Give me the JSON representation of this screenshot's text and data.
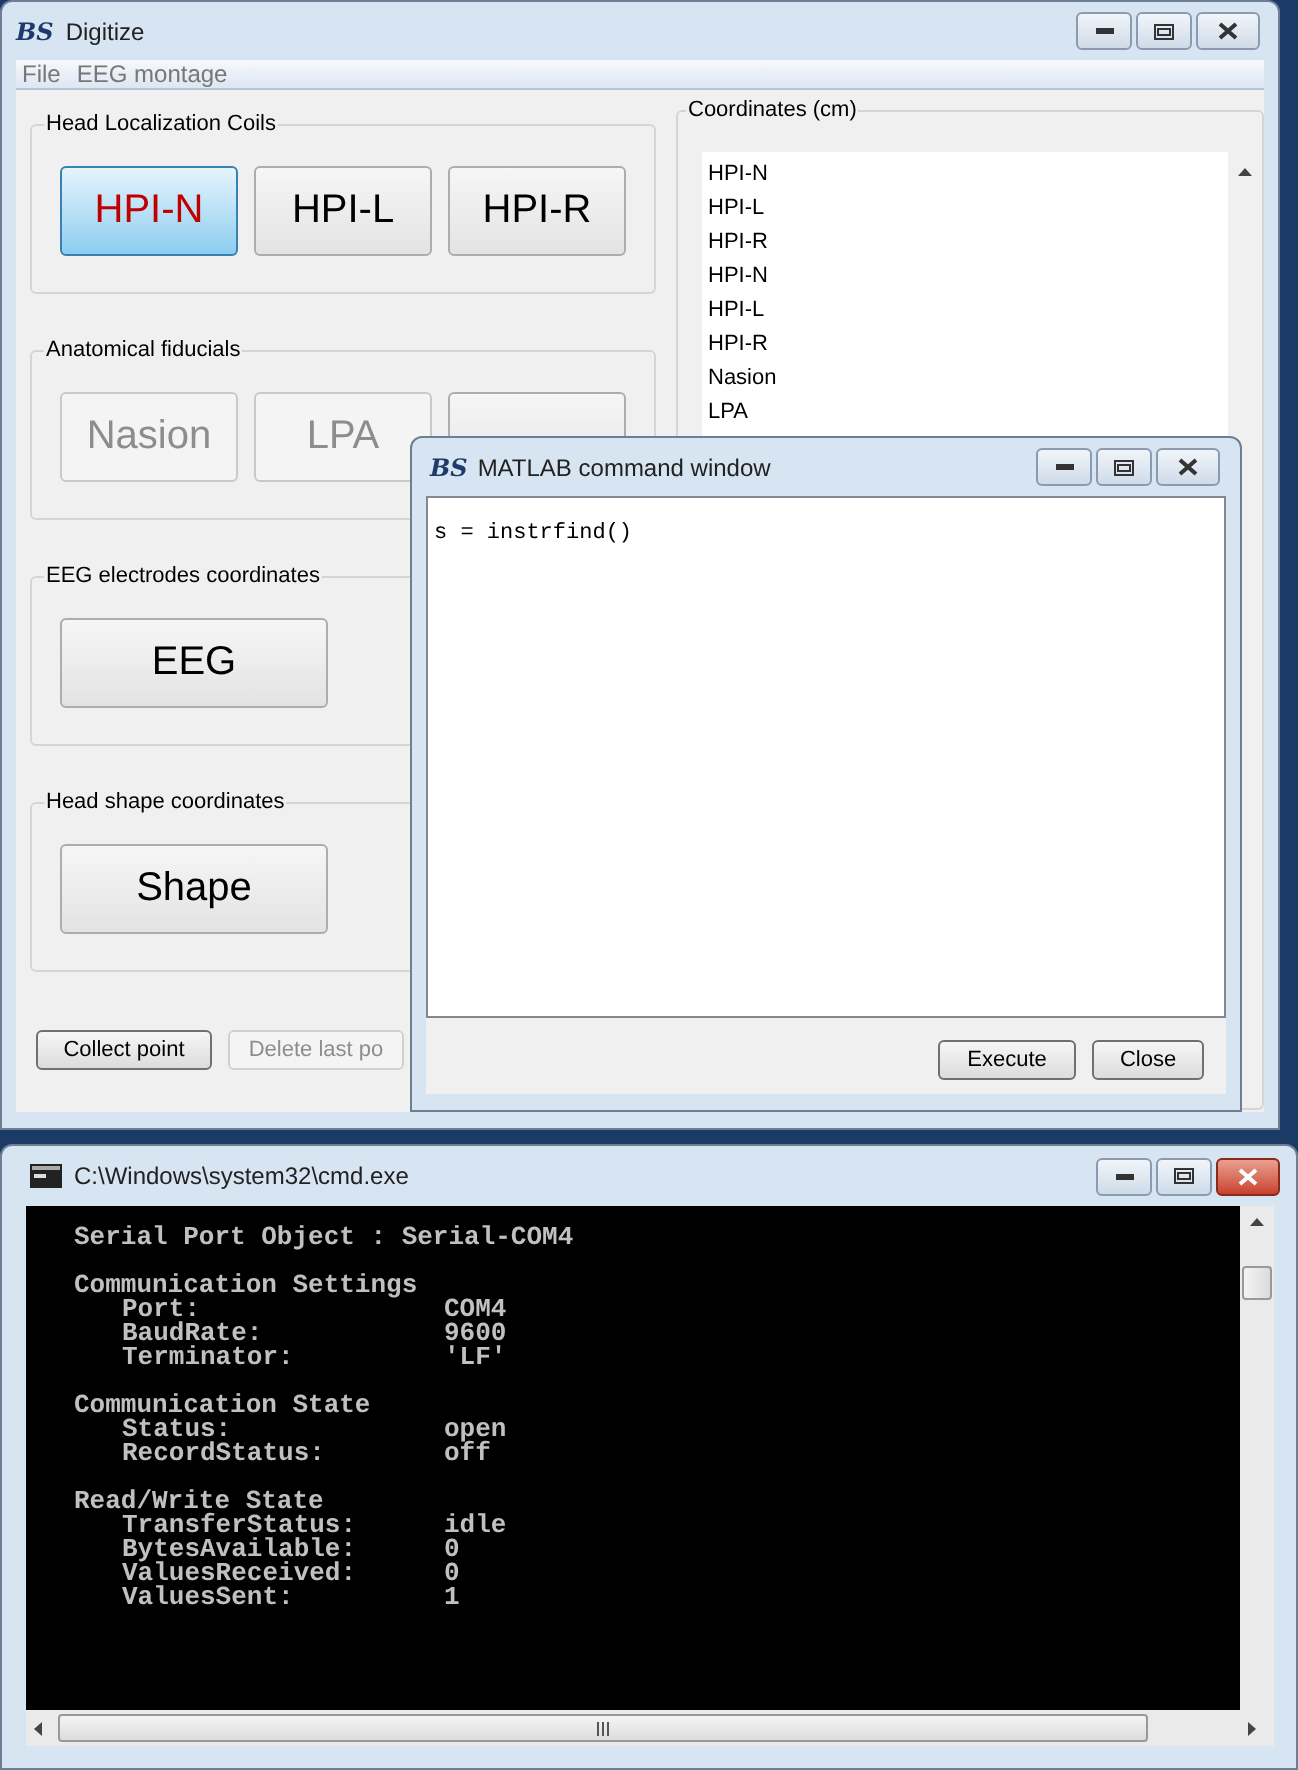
{
  "digitize_window": {
    "logo": "BS",
    "title": "Digitize",
    "menu": [
      "File",
      "EEG montage"
    ],
    "groups": [
      {
        "title": "Head Localization Coils",
        "buttons": [
          {
            "label": "HPI-N",
            "selected": true,
            "disabled": false
          },
          {
            "label": "HPI-L",
            "selected": false,
            "disabled": false
          },
          {
            "label": "HPI-R",
            "selected": false,
            "disabled": false
          }
        ]
      },
      {
        "title": "Anatomical fiducials",
        "buttons": [
          {
            "label": "Nasion",
            "selected": false,
            "disabled": true
          },
          {
            "label": "LPA",
            "selected": false,
            "disabled": true
          },
          {
            "selected": false,
            "disabled": false
          }
        ]
      },
      {
        "title": "EEG electrodes coordinates",
        "buttons": [
          {
            "label": "EEG",
            "selected": false,
            "disabled": false,
            "kind": "wide"
          }
        ]
      },
      {
        "title": "Head shape coordinates",
        "buttons": [
          {
            "label": "Shape",
            "selected": false,
            "disabled": false,
            "kind": "wide"
          }
        ]
      }
    ],
    "bottom_buttons": [
      {
        "label": "Collect point",
        "disabled": false
      },
      {
        "label": "Delete last po",
        "disabled": true
      }
    ],
    "coordinates": {
      "title": "Coordinates (cm)",
      "items": [
        "HPI-N",
        "HPI-L",
        "HPI-R",
        "HPI-N",
        "HPI-L",
        "HPI-R",
        "Nasion",
        "LPA"
      ]
    }
  },
  "matlab_window": {
    "logo": "BS",
    "title": "MATLAB command window",
    "command": "s = instrfind()",
    "buttons": [
      "Execute",
      "Close"
    ]
  },
  "cmd_window": {
    "title": "C:\\Windows\\system32\\cmd.exe",
    "heading": "Serial Port Object : Serial-COM4",
    "sections": [
      {
        "title": "Communication Settings",
        "rows": [
          {
            "label": "Port:",
            "value": "COM4"
          },
          {
            "label": "BaudRate:",
            "value": "9600"
          },
          {
            "label": "Terminator:",
            "value": "'LF'"
          }
        ]
      },
      {
        "title": "Communication State",
        "rows": [
          {
            "label": "Status:",
            "value": "open"
          },
          {
            "label": "RecordStatus:",
            "value": "off"
          }
        ]
      },
      {
        "title": "Read/Write State",
        "rows": [
          {
            "label": "TransferStatus:",
            "value": "idle"
          },
          {
            "label": "BytesAvailable:",
            "value": "0"
          },
          {
            "label": "ValuesReceived:",
            "value": "0"
          },
          {
            "label": "ValuesSent:",
            "value": "1"
          }
        ]
      }
    ]
  }
}
